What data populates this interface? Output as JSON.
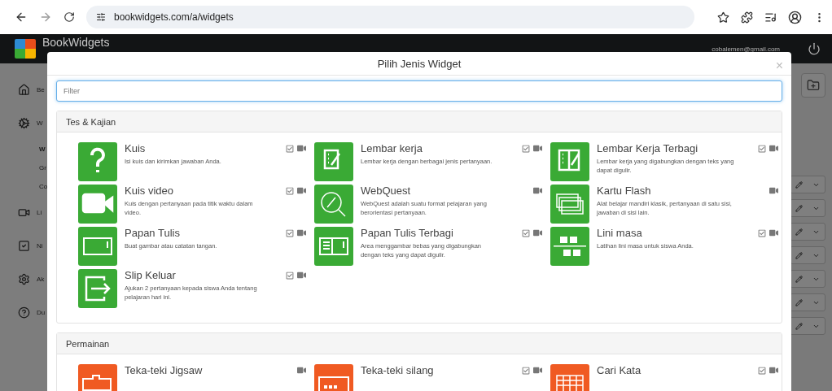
{
  "browser": {
    "url": "bookwidgets.com/a/widgets"
  },
  "app": {
    "logo": "BookWidgets",
    "email": "cobalemen@gmail.com"
  },
  "sidebar": [
    {
      "label": "Be",
      "kind": "home",
      "bold": false
    },
    {
      "label": "W",
      "kind": "gears",
      "bold": false
    },
    {
      "label": "W",
      "kind": "sub",
      "bold": true
    },
    {
      "label": "Gr",
      "kind": "sub",
      "bold": false
    },
    {
      "label": "Co",
      "kind": "sub",
      "bold": false
    },
    {
      "label": "Li",
      "kind": "video",
      "bold": false
    },
    {
      "label": "Ni",
      "kind": "check",
      "bold": false
    },
    {
      "label": "Ak",
      "kind": "gear",
      "bold": false
    },
    {
      "label": "Du",
      "kind": "help",
      "bold": false
    }
  ],
  "modal": {
    "title": "Pilih Jenis Widget",
    "close": "×",
    "filter": {
      "placeholder": "Filter"
    },
    "sections": [
      {
        "title": "Tes & Kajian",
        "color": "#3aaa35",
        "items": [
          {
            "title": "Kuis",
            "description": "Isi kuis dan kirimkan jawaban Anda.",
            "gradable": true,
            "video": true
          },
          {
            "title": "Lembar kerja",
            "description": "Lembar kerja dengan berbagai jenis pertanyaan.",
            "gradable": true,
            "video": true
          },
          {
            "title": "Lembar Kerja Terbagi",
            "description": "Lembar kerja yang digabungkan dengan teks yang dapat digulir.",
            "gradable": true,
            "video": true
          },
          {
            "title": "Kuis video",
            "description": "Kuis dengan pertanyaan pada titik waktu dalam video.",
            "gradable": true,
            "video": true
          },
          {
            "title": "WebQuest",
            "description": "WebQuest adalah suatu format pelajaran yang berorientasi pertanyaan.",
            "gradable": false,
            "video": true
          },
          {
            "title": "Kartu Flash",
            "description": "Alat belajar mandiri klasik, pertanyaan di satu sisi, jawaban di sisi lain.",
            "gradable": false,
            "video": true
          },
          {
            "title": "Papan Tulis",
            "description": "Buat gambar atau catatan tangan.",
            "gradable": true,
            "video": true
          },
          {
            "title": "Papan Tulis Terbagi",
            "description": "Area menggambar bebas yang digabungkan dengan teks yang dapat digulir.",
            "gradable": true,
            "video": true
          },
          {
            "title": "Lini masa",
            "description": "Latihan lini masa untuk siswa Anda.",
            "gradable": true,
            "video": true
          },
          {
            "title": "Slip Keluar",
            "description": "Ajukan 2 pertanyaan kepada siswa Anda tentang pelajaran hari ini.",
            "gradable": true,
            "video": true
          }
        ]
      },
      {
        "title": "Permainan",
        "color": "#f05a22",
        "items": [
          {
            "title": "Teka-teki Jigsaw",
            "gradable": false,
            "video": true
          },
          {
            "title": "Teka-teki silang",
            "gradable": true,
            "video": true
          },
          {
            "title": "Cari Kata",
            "gradable": true,
            "video": true
          }
        ]
      }
    ]
  }
}
